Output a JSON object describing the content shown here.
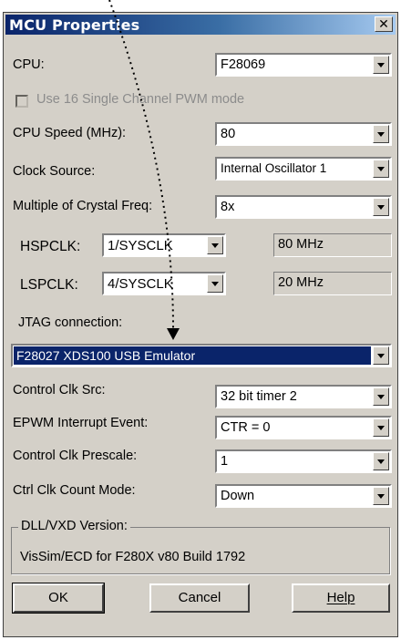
{
  "window": {
    "title": "MCU Properties",
    "close_icon": "close-icon"
  },
  "cpu": {
    "label": "CPU:",
    "value": "F28069"
  },
  "pwm_mode": {
    "label": "Use 16 Single Channel PWM mode",
    "checked": false
  },
  "cpu_speed": {
    "label": "CPU Speed (MHz):",
    "value": "80"
  },
  "clock_source": {
    "label": "Clock Source:",
    "value": "Internal Oscillator 1"
  },
  "crystal_multiple": {
    "label": "Multiple of Crystal Freq:",
    "value": "8x"
  },
  "hspclk": {
    "label": "HSPCLK:",
    "value": "1/SYSCLK",
    "freq": "80 MHz"
  },
  "lspclk": {
    "label": "LSPCLK:",
    "value": "4/SYSCLK",
    "freq": "20 MHz"
  },
  "jtag": {
    "label": "JTAG connection:",
    "value": "F28027 XDS100 USB Emulator"
  },
  "control_clk_src": {
    "label": "Control Clk Src:",
    "value": "32 bit timer 2"
  },
  "epwm_interrupt": {
    "label": "EPWM Interrupt Event:",
    "value": "CTR = 0"
  },
  "control_clk_prescale": {
    "label": "Control Clk Prescale:",
    "value": "1"
  },
  "ctrl_clk_count_mode": {
    "label": "Ctrl Clk Count Mode:",
    "value": "Down"
  },
  "dll_version": {
    "title": "DLL/VXD Version:",
    "text": "VisSim/ECD for F280X v80 Build 1792"
  },
  "buttons": {
    "ok": "OK",
    "cancel": "Cancel",
    "help": "Help"
  },
  "colors": {
    "title_start": "#0a246a",
    "title_end": "#a6caf0",
    "face": "#d4d0c8",
    "selection": "#0a246a"
  }
}
